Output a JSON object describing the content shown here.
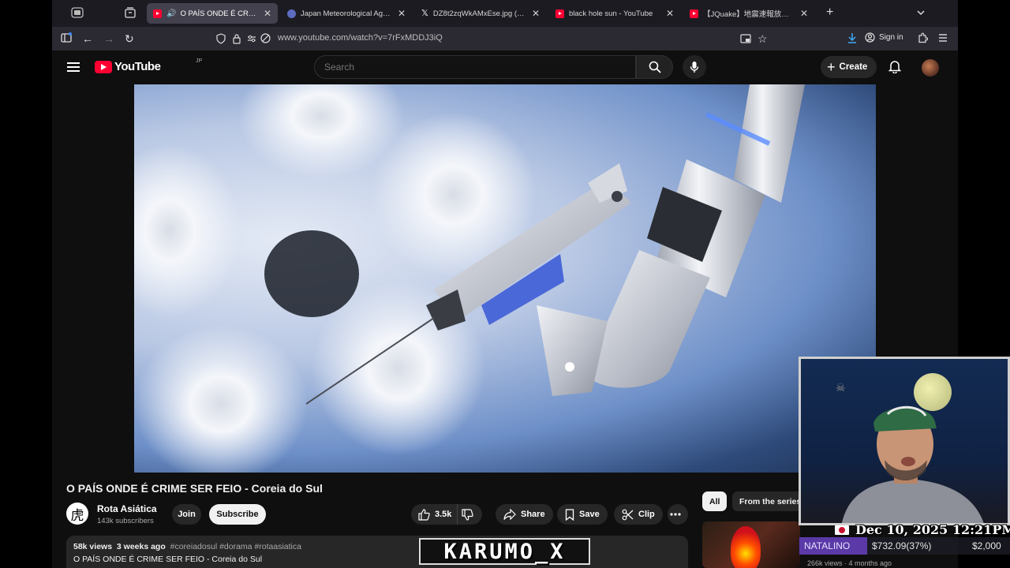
{
  "browser": {
    "tabs": [
      {
        "title": "O PAÍS ONDE É CRIME SER FEIO - Coreia do Sul",
        "favicon": "youtube-icon",
        "active": true,
        "playing_audio": true
      },
      {
        "title": "Japan Meteorological Agency | Weather",
        "favicon": "jma-icon",
        "active": false
      },
      {
        "title": "DZ8t2zqWkAMxEse.jpg (JPEG Image)",
        "favicon": "x-icon",
        "active": false
      },
      {
        "title": "black hole sun - YouTube",
        "favicon": "youtube-icon",
        "active": false
      },
      {
        "title": "【JQuake】地震速報放送24時間",
        "favicon": "youtube-icon",
        "active": false
      }
    ],
    "new_tab": "+",
    "url": "www.youtube.com/watch?v=7rFxMDDJ3iQ",
    "signin_label": "Sign in"
  },
  "youtube": {
    "logo_text": "YouTube",
    "country_code": "JP",
    "search_placeholder": "Search",
    "create_label": "Create"
  },
  "video": {
    "title": "O PAÍS ONDE É CRIME SER FEIO - Coreia do Sul",
    "channel_name": "Rota Asiática",
    "channel_avatar_char": "虎",
    "subscribers": "143k subscribers",
    "join_label": "Join",
    "subscribe_label": "Subscribe",
    "likes": "3.5k",
    "share_label": "Share",
    "save_label": "Save",
    "clip_label": "Clip",
    "views": "58k views",
    "age": "3 weeks ago",
    "tags": "#coreiadosul #dorama #rotaasiatica",
    "description": "O PAÍS ONDE É CRIME SER FEIO - Coreia do Sul"
  },
  "sidebar": {
    "chips": [
      "All",
      "From the series"
    ],
    "first_rec_meta": "266k views · 4 months ago"
  },
  "stream_overlay": {
    "watermark": "KARUMO_X",
    "datetime": "Dec 10, 2025 12:21PM",
    "donor": "NATALINO",
    "amount": "$732.09(37%)",
    "goal": "$2,000"
  }
}
